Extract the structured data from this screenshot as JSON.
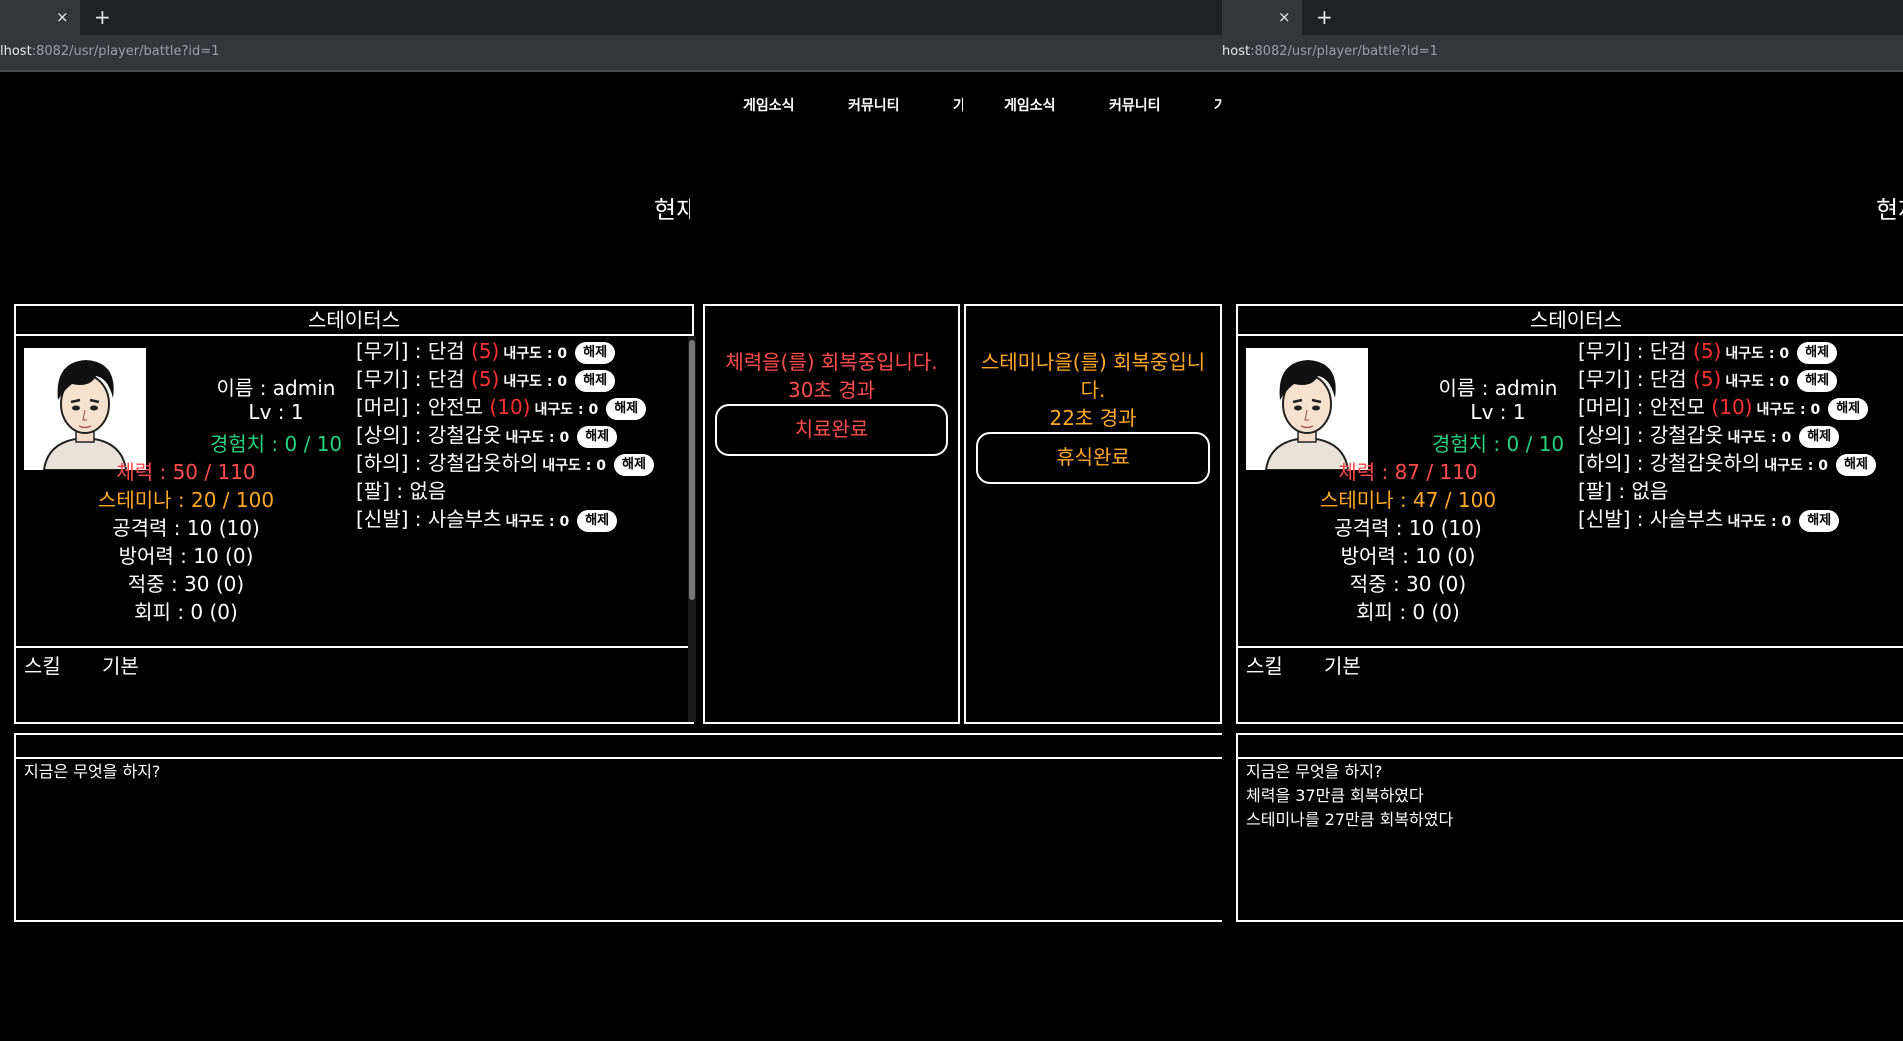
{
  "browser": {
    "close_glyph": "×",
    "new_tab_glyph": "+",
    "url_host": "lhost",
    "url_rest": ":8082/usr/player/battle?id=1",
    "url_host_right": "host"
  },
  "nav": {
    "item1": "게임소식",
    "item2": "커뮤니티",
    "item3": "가"
  },
  "heading": "현재",
  "status": {
    "title": "스테이터스",
    "name": "이름 : admin",
    "level": "Lv : 1",
    "exp": "경험치 : 0 / 10",
    "attack": "공격력 : 10 (10)",
    "defense": "방어력 : 10 (0)",
    "accuracy": "적중 : 30 (0)",
    "evasion": "회피 : 0 (0)"
  },
  "left_state": {
    "hp": "체력 : 50 / 110",
    "stamina": "스테미나 : 20 / 100"
  },
  "right_state": {
    "hp": "체력 : 87 / 110",
    "stamina": "스테미나 : 47 / 100"
  },
  "equipment": [
    {
      "slot": "[무기] : 단검",
      "level": "(5)",
      "durability": "내구도 : 0",
      "release": "해제"
    },
    {
      "slot": "[무기] : 단검",
      "level": "(5)",
      "durability": "내구도 : 0",
      "release": "해제"
    },
    {
      "slot": "[머리] : 안전모",
      "level": "(10)",
      "durability": "내구도 : 0",
      "release": "해제"
    },
    {
      "slot": "[상의] : 강철갑옷",
      "level": "",
      "durability": "내구도 : 0",
      "release": "해제"
    },
    {
      "slot": "[하의] : 강철갑옷하의",
      "level": "",
      "durability": "내구도 : 0",
      "release": "해제"
    },
    {
      "slot": "[팔] : 없음",
      "level": "",
      "durability": "",
      "release": ""
    },
    {
      "slot": "[신발] : 사슬부츠",
      "level": "",
      "durability": "내구도 : 0",
      "release": "해제"
    }
  ],
  "skills": {
    "label": "스킬",
    "basic": "기본"
  },
  "recover_hp": {
    "line1": "체력을(를) 회복중입니다.",
    "line2": "30초 경과",
    "button": "치료완료"
  },
  "recover_st": {
    "line1": "스테미나을(를) 회복중입니",
    "line1b": "다.",
    "line2": "22초 경과",
    "button": "휴식완료"
  },
  "log_left": [
    "지금은 무엇을 하지?"
  ],
  "log_right": [
    "지금은 무엇을 하지?",
    "체력을 37만큼 회복하였다",
    "스테미나를 27만큼 회복하였다"
  ]
}
